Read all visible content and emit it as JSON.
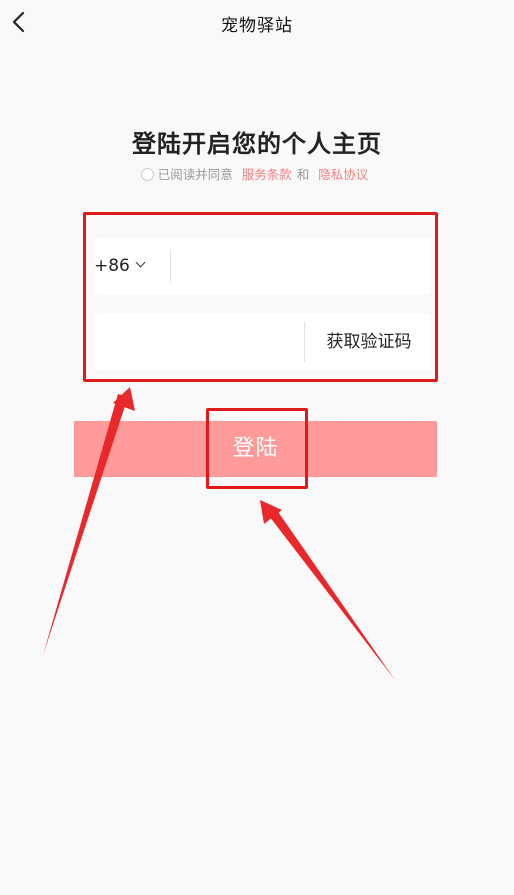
{
  "nav": {
    "title": "宠物驿站"
  },
  "headline": "登陆开启您的个人主页",
  "agreement": {
    "prefix": "已阅读并同意",
    "terms_link": "服务条款",
    "conjunction": "和",
    "privacy_link": "隐私协议",
    "checked": false
  },
  "form": {
    "country_code": "+86",
    "phone_value": "",
    "code_value": "",
    "get_code_label": "获取验证码"
  },
  "login_button": {
    "label": "登陆",
    "color": "#ff9a9a"
  },
  "annotations": {
    "highlight_color": "#e01a1a",
    "arrow_color": "#e8282a"
  }
}
